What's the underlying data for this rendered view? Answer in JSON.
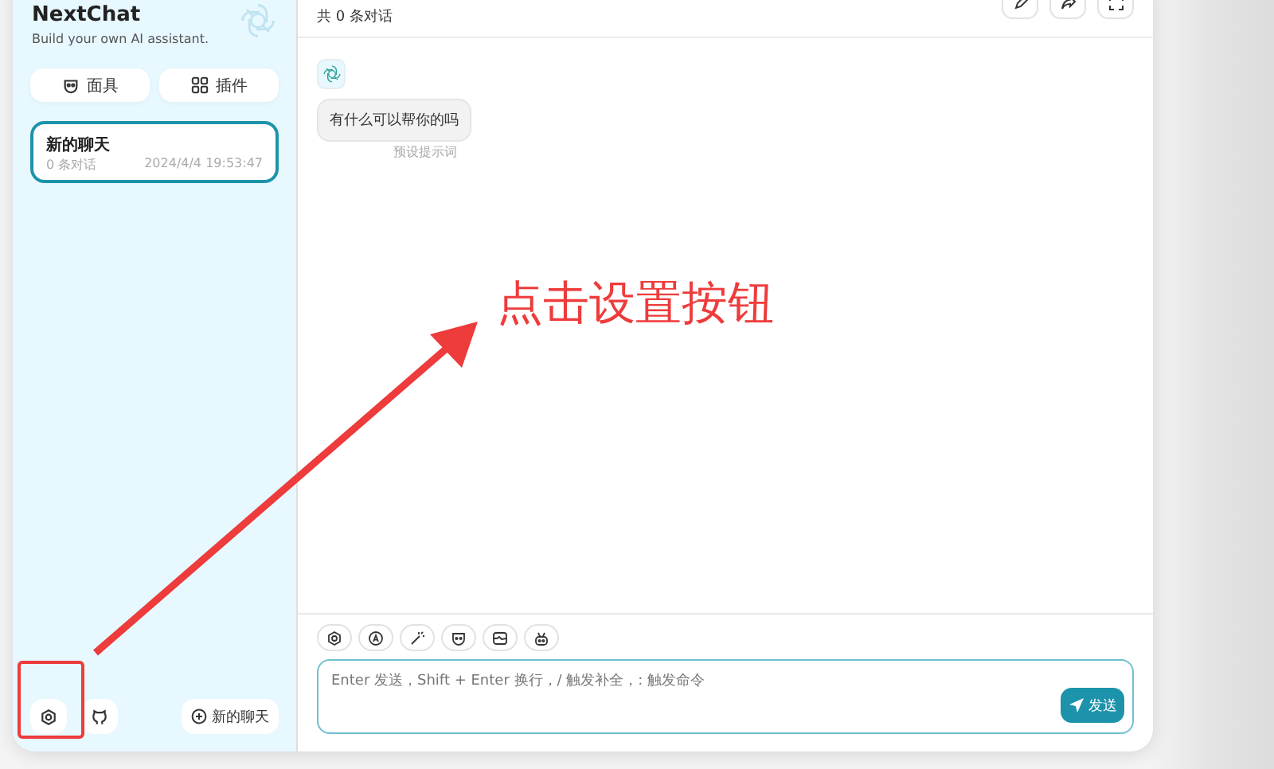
{
  "sidebar": {
    "title": "NextChat",
    "subtitle": "Build your own AI assistant.",
    "buttons": [
      {
        "kind": "mask",
        "label": "面具"
      },
      {
        "kind": "plugin",
        "label": "插件"
      }
    ],
    "chats": [
      {
        "title": "新的聊天",
        "count": "0 条对话",
        "time": "2024/4/4 19:53:47",
        "selected": true
      }
    ],
    "new_chat": "新的聊天"
  },
  "chat": {
    "subtitle": "共 0 条对话",
    "messages": [
      {
        "text": "有什么可以帮你的吗",
        "note": "预设提示词"
      }
    ],
    "input": {
      "placeholder": "Enter 发送，Shift + Enter 换行，/ 触发补全，: 触发命令"
    },
    "send": "发送"
  },
  "annotation": {
    "text": "点击设置按钮"
  }
}
